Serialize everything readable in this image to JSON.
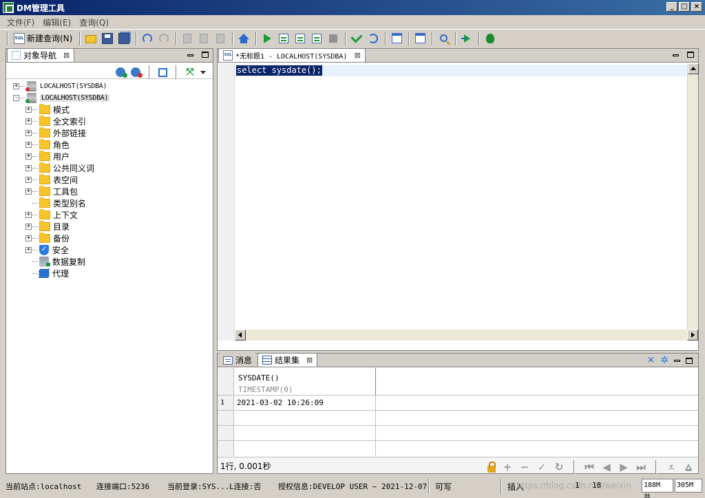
{
  "window": {
    "title": "DM管理工具"
  },
  "menu": [
    "文件(F)",
    "编辑(E)",
    "查询(Q)"
  ],
  "toolbar": {
    "new_query_label": "新建查询(N)"
  },
  "nav_panel": {
    "tab_label": "对象导航",
    "tree": [
      {
        "label": "LOCALHOST(SYSDBA)",
        "expander": "+",
        "icon": "database-icon",
        "status_color": "#d03030",
        "depth": 0
      },
      {
        "label": "LOCALHOST(SYSDBA)",
        "expander": "-",
        "icon": "database-icon",
        "status_color": "#1a9a3a",
        "depth": 0,
        "selected": true
      },
      {
        "label": "模式",
        "expander": "+",
        "icon": "folder-icon",
        "depth": 1
      },
      {
        "label": "全文索引",
        "expander": "+",
        "icon": "folder-icon",
        "depth": 1
      },
      {
        "label": "外部链接",
        "expander": "+",
        "icon": "folder-icon",
        "depth": 1
      },
      {
        "label": "角色",
        "expander": "+",
        "icon": "folder-icon",
        "depth": 1
      },
      {
        "label": "用户",
        "expander": "+",
        "icon": "folder-icon",
        "depth": 1
      },
      {
        "label": "公共同义词",
        "expander": "+",
        "icon": "folder-icon",
        "depth": 1
      },
      {
        "label": "表空间",
        "expander": "+",
        "icon": "folder-icon",
        "depth": 1
      },
      {
        "label": "工具包",
        "expander": "+",
        "icon": "folder-icon",
        "depth": 1
      },
      {
        "label": "类型别名",
        "expander": "",
        "icon": "folder-icon",
        "depth": 1
      },
      {
        "label": "上下文",
        "expander": "+",
        "icon": "folder-icon",
        "depth": 1
      },
      {
        "label": "目录",
        "expander": "+",
        "icon": "folder-icon",
        "depth": 1
      },
      {
        "label": "备份",
        "expander": "+",
        "icon": "folder-icon",
        "depth": 1
      },
      {
        "label": "安全",
        "expander": "+",
        "icon": "shield-icon",
        "depth": 1
      },
      {
        "label": "数据复制",
        "expander": "",
        "icon": "replication-icon",
        "depth": 1
      },
      {
        "label": "代理",
        "expander": "",
        "icon": "layers-icon",
        "depth": 1
      }
    ]
  },
  "editor": {
    "tab_label": "*无标题1 - LOCALHOST(SYSDBA)",
    "code": "select sysdate();",
    "selection_color": "#0a246a"
  },
  "results": {
    "tabs": [
      {
        "label": "消息"
      },
      {
        "label": "结果集"
      }
    ],
    "column": {
      "name": "SYSDATE()",
      "type": "TIMESTAMP(0)"
    },
    "rows": [
      {
        "num": "1",
        "value": "2021-03-02 10:26:09"
      }
    ],
    "summary": "1行, 0.001秒"
  },
  "status": {
    "site": "当前站点:localhost",
    "port": "连接端口:5236",
    "login": "当前登录:SYS...",
    "ssl": "L连接:否",
    "license": "授权信息:DEVELOP USER ~ 2021-12-07",
    "mode": "可写",
    "insert": "插入",
    "line": "1",
    "col": "18",
    "mem_used": "188M 共",
    "mem_total": "305M",
    "watermark": "https://blog.csdn.net/weixin"
  }
}
